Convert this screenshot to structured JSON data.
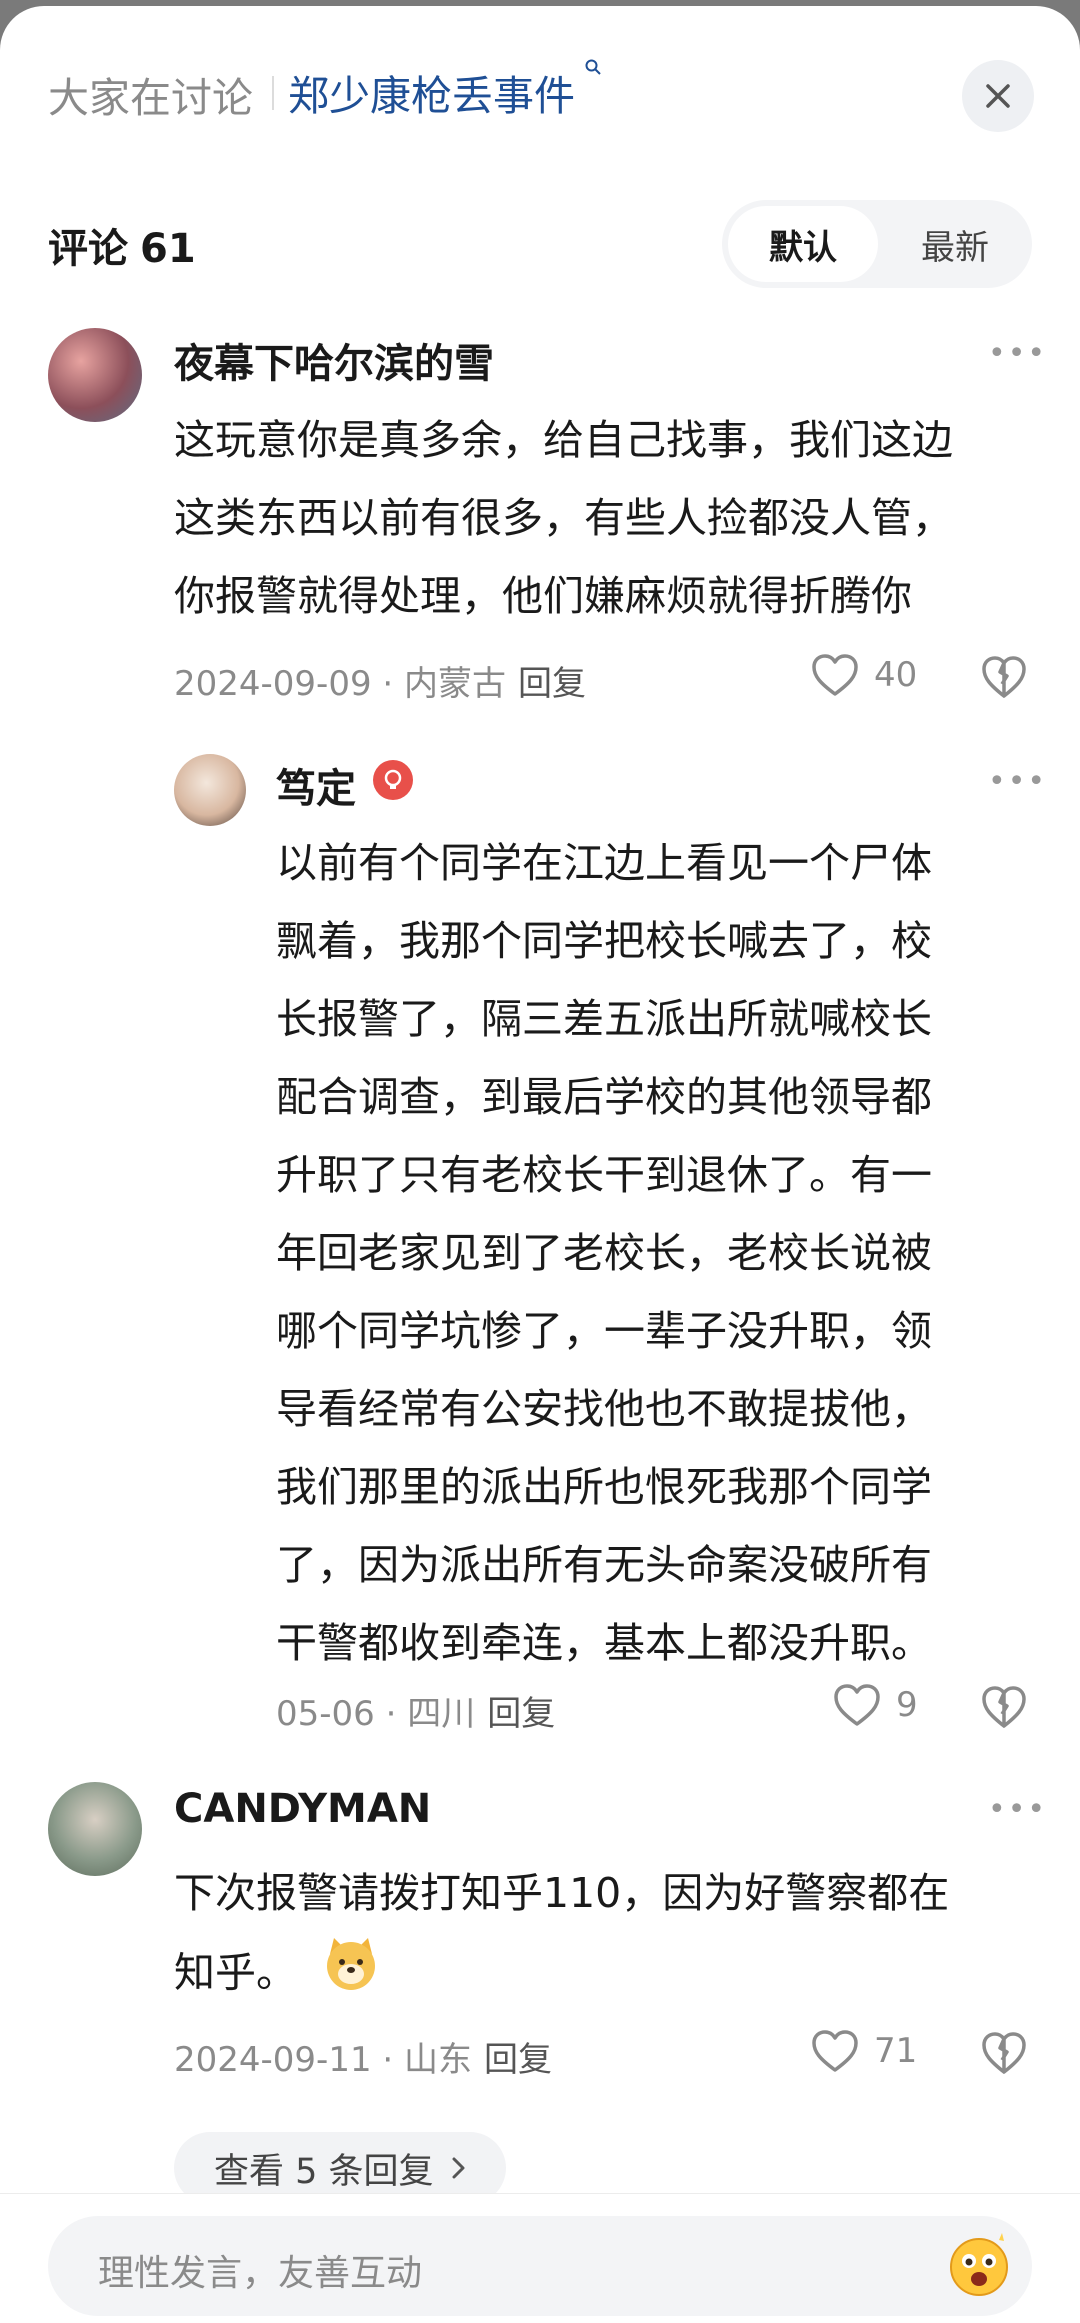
{
  "header": {
    "prefix": "大家在讨论",
    "topic": "郑少康枪丢事件"
  },
  "comments_bar": {
    "title": "评论",
    "count": "61",
    "sort_default": "默认",
    "sort_latest": "最新"
  },
  "comments": [
    {
      "user": "夜幕下哈尔滨的雪",
      "lines": [
        "这玩意你是真多余，给自己找事，我们这边",
        "这类东西以前有很多，有些人捡都没人管，",
        "你报警就得处理，他们嫌麻烦就得折腾你"
      ],
      "meta": "2024-09-09 · 内蒙古",
      "reply": "回复",
      "likes": "40"
    },
    {
      "user": "笃定",
      "lines": [
        "以前有个同学在江边上看见一个尸体",
        "飘着，我那个同学把校长喊去了，校",
        "长报警了，隔三差五派出所就喊校长",
        "配合调查，到最后学校的其他领导都",
        "升职了只有老校长干到退休了。有一",
        "年回老家见到了老校长，老校长说被",
        "哪个同学坑惨了，一辈子没升职，领",
        "导看经常有公安找他也不敢提拔他，",
        "我们那里的派出所也恨死我那个同学",
        "了，因为派出所有无头命案没破所有",
        "干警都收到牵连，基本上都没升职。"
      ],
      "meta": "05-06 · 四川",
      "reply": "回复",
      "likes": "9"
    },
    {
      "user": "CANDYMAN",
      "lines": [
        "下次报警请拨打知乎110，因为好警察都在",
        "知乎。"
      ],
      "meta": "2024-09-11 · 山东",
      "reply": "回复",
      "likes": "71",
      "view_replies": "查看 5 条回复"
    }
  ],
  "input": {
    "placeholder": "理性发言，友善互动"
  },
  "colors": {
    "topic": "#1f4f95",
    "muted": "#8a8a8a",
    "badge": "#e8504a"
  }
}
